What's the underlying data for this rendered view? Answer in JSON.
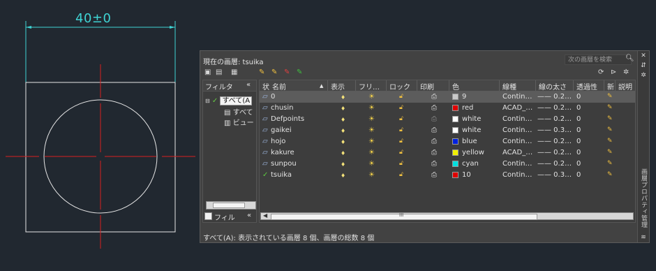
{
  "drawing": {
    "dimension_text": "40±0"
  },
  "palette": {
    "current_layer_label": "現在の画層: tsuika",
    "search_placeholder": "次の画層を検索",
    "side_title": "画層プロパティ管理",
    "left": {
      "header": "フィルタ",
      "collapse": "«",
      "tree": [
        "すべて(A",
        "すべて",
        "ビュー"
      ],
      "filter_invert": "フィル",
      "filter_collapse": "«"
    },
    "columns": [
      "状",
      "名前",
      "表示",
      "フリ…",
      "ロック",
      "印刷",
      "色",
      "線種",
      "線の太さ",
      "透過性",
      "新",
      "説明"
    ],
    "layers": [
      {
        "name": "0",
        "color_name": "9",
        "color_hex": "#c8c8c8",
        "linetype": "Contin…",
        "lineweight": "—— 0.2…",
        "transparency": "0",
        "current": false,
        "plot_off": false
      },
      {
        "name": "chusin",
        "color_name": "red",
        "color_hex": "#e00000",
        "linetype": "ACAD_…",
        "lineweight": "—— 0.2…",
        "transparency": "0",
        "current": false,
        "plot_off": false
      },
      {
        "name": "Defpoints",
        "color_name": "white",
        "color_hex": "#ffffff",
        "linetype": "Contin…",
        "lineweight": "—— 0.2…",
        "transparency": "0",
        "current": false,
        "plot_off": true
      },
      {
        "name": "gaikei",
        "color_name": "white",
        "color_hex": "#ffffff",
        "linetype": "Contin…",
        "lineweight": "—— 0.3…",
        "transparency": "0",
        "current": false,
        "plot_off": false
      },
      {
        "name": "hojo",
        "color_name": "blue",
        "color_hex": "#0020e0",
        "linetype": "Contin…",
        "lineweight": "—— 0.2…",
        "transparency": "0",
        "current": false,
        "plot_off": false
      },
      {
        "name": "kakure",
        "color_name": "yellow",
        "color_hex": "#f0f000",
        "linetype": "ACAD_…",
        "lineweight": "—— 0.2…",
        "transparency": "0",
        "current": false,
        "plot_off": false
      },
      {
        "name": "sunpou",
        "color_name": "cyan",
        "color_hex": "#00e0e0",
        "linetype": "Contin…",
        "lineweight": "—— 0.2…",
        "transparency": "0",
        "current": false,
        "plot_off": false
      },
      {
        "name": "tsuika",
        "color_name": "10",
        "color_hex": "#e00000",
        "linetype": "Contin…",
        "lineweight": "—— 0.3…",
        "transparency": "0",
        "current": true,
        "plot_off": false
      }
    ],
    "scroll_mark": "III",
    "status": "すべて(A): 表示されている画層 8 個、画層の総数 8 個"
  }
}
